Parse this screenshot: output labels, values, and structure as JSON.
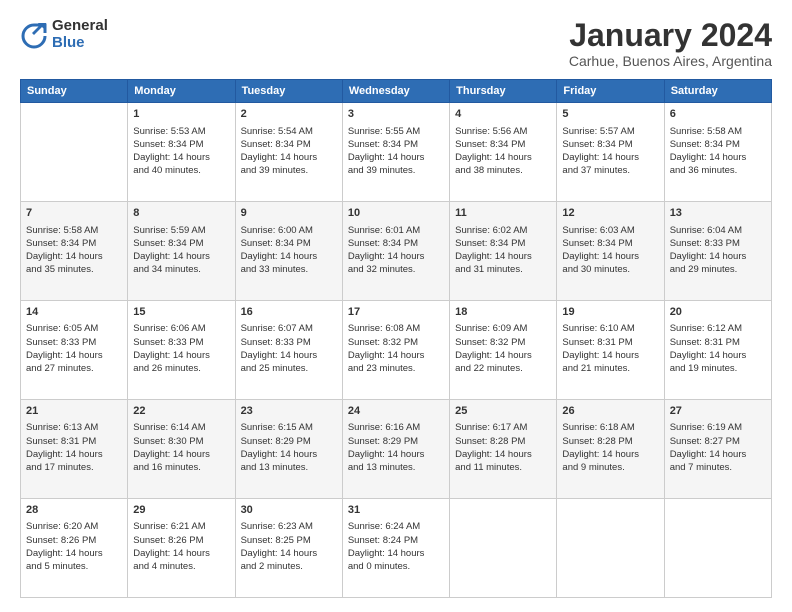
{
  "logo": {
    "general": "General",
    "blue": "Blue"
  },
  "title": "January 2024",
  "subtitle": "Carhue, Buenos Aires, Argentina",
  "days_header": [
    "Sunday",
    "Monday",
    "Tuesday",
    "Wednesday",
    "Thursday",
    "Friday",
    "Saturday"
  ],
  "weeks": [
    [
      {
        "num": "",
        "info": ""
      },
      {
        "num": "1",
        "info": "Sunrise: 5:53 AM\nSunset: 8:34 PM\nDaylight: 14 hours\nand 40 minutes."
      },
      {
        "num": "2",
        "info": "Sunrise: 5:54 AM\nSunset: 8:34 PM\nDaylight: 14 hours\nand 39 minutes."
      },
      {
        "num": "3",
        "info": "Sunrise: 5:55 AM\nSunset: 8:34 PM\nDaylight: 14 hours\nand 39 minutes."
      },
      {
        "num": "4",
        "info": "Sunrise: 5:56 AM\nSunset: 8:34 PM\nDaylight: 14 hours\nand 38 minutes."
      },
      {
        "num": "5",
        "info": "Sunrise: 5:57 AM\nSunset: 8:34 PM\nDaylight: 14 hours\nand 37 minutes."
      },
      {
        "num": "6",
        "info": "Sunrise: 5:58 AM\nSunset: 8:34 PM\nDaylight: 14 hours\nand 36 minutes."
      }
    ],
    [
      {
        "num": "7",
        "info": "Sunrise: 5:58 AM\nSunset: 8:34 PM\nDaylight: 14 hours\nand 35 minutes."
      },
      {
        "num": "8",
        "info": "Sunrise: 5:59 AM\nSunset: 8:34 PM\nDaylight: 14 hours\nand 34 minutes."
      },
      {
        "num": "9",
        "info": "Sunrise: 6:00 AM\nSunset: 8:34 PM\nDaylight: 14 hours\nand 33 minutes."
      },
      {
        "num": "10",
        "info": "Sunrise: 6:01 AM\nSunset: 8:34 PM\nDaylight: 14 hours\nand 32 minutes."
      },
      {
        "num": "11",
        "info": "Sunrise: 6:02 AM\nSunset: 8:34 PM\nDaylight: 14 hours\nand 31 minutes."
      },
      {
        "num": "12",
        "info": "Sunrise: 6:03 AM\nSunset: 8:34 PM\nDaylight: 14 hours\nand 30 minutes."
      },
      {
        "num": "13",
        "info": "Sunrise: 6:04 AM\nSunset: 8:33 PM\nDaylight: 14 hours\nand 29 minutes."
      }
    ],
    [
      {
        "num": "14",
        "info": "Sunrise: 6:05 AM\nSunset: 8:33 PM\nDaylight: 14 hours\nand 27 minutes."
      },
      {
        "num": "15",
        "info": "Sunrise: 6:06 AM\nSunset: 8:33 PM\nDaylight: 14 hours\nand 26 minutes."
      },
      {
        "num": "16",
        "info": "Sunrise: 6:07 AM\nSunset: 8:33 PM\nDaylight: 14 hours\nand 25 minutes."
      },
      {
        "num": "17",
        "info": "Sunrise: 6:08 AM\nSunset: 8:32 PM\nDaylight: 14 hours\nand 23 minutes."
      },
      {
        "num": "18",
        "info": "Sunrise: 6:09 AM\nSunset: 8:32 PM\nDaylight: 14 hours\nand 22 minutes."
      },
      {
        "num": "19",
        "info": "Sunrise: 6:10 AM\nSunset: 8:31 PM\nDaylight: 14 hours\nand 21 minutes."
      },
      {
        "num": "20",
        "info": "Sunrise: 6:12 AM\nSunset: 8:31 PM\nDaylight: 14 hours\nand 19 minutes."
      }
    ],
    [
      {
        "num": "21",
        "info": "Sunrise: 6:13 AM\nSunset: 8:31 PM\nDaylight: 14 hours\nand 17 minutes."
      },
      {
        "num": "22",
        "info": "Sunrise: 6:14 AM\nSunset: 8:30 PM\nDaylight: 14 hours\nand 16 minutes."
      },
      {
        "num": "23",
        "info": "Sunrise: 6:15 AM\nSunset: 8:29 PM\nDaylight: 14 hours\nand 13 minutes."
      },
      {
        "num": "24",
        "info": "Sunrise: 6:16 AM\nSunset: 8:29 PM\nDaylight: 14 hours\nand 13 minutes."
      },
      {
        "num": "25",
        "info": "Sunrise: 6:17 AM\nSunset: 8:28 PM\nDaylight: 14 hours\nand 11 minutes."
      },
      {
        "num": "26",
        "info": "Sunrise: 6:18 AM\nSunset: 8:28 PM\nDaylight: 14 hours\nand 9 minutes."
      },
      {
        "num": "27",
        "info": "Sunrise: 6:19 AM\nSunset: 8:27 PM\nDaylight: 14 hours\nand 7 minutes."
      }
    ],
    [
      {
        "num": "28",
        "info": "Sunrise: 6:20 AM\nSunset: 8:26 PM\nDaylight: 14 hours\nand 5 minutes."
      },
      {
        "num": "29",
        "info": "Sunrise: 6:21 AM\nSunset: 8:26 PM\nDaylight: 14 hours\nand 4 minutes."
      },
      {
        "num": "30",
        "info": "Sunrise: 6:23 AM\nSunset: 8:25 PM\nDaylight: 14 hours\nand 2 minutes."
      },
      {
        "num": "31",
        "info": "Sunrise: 6:24 AM\nSunset: 8:24 PM\nDaylight: 14 hours\nand 0 minutes."
      },
      {
        "num": "",
        "info": ""
      },
      {
        "num": "",
        "info": ""
      },
      {
        "num": "",
        "info": ""
      }
    ]
  ]
}
